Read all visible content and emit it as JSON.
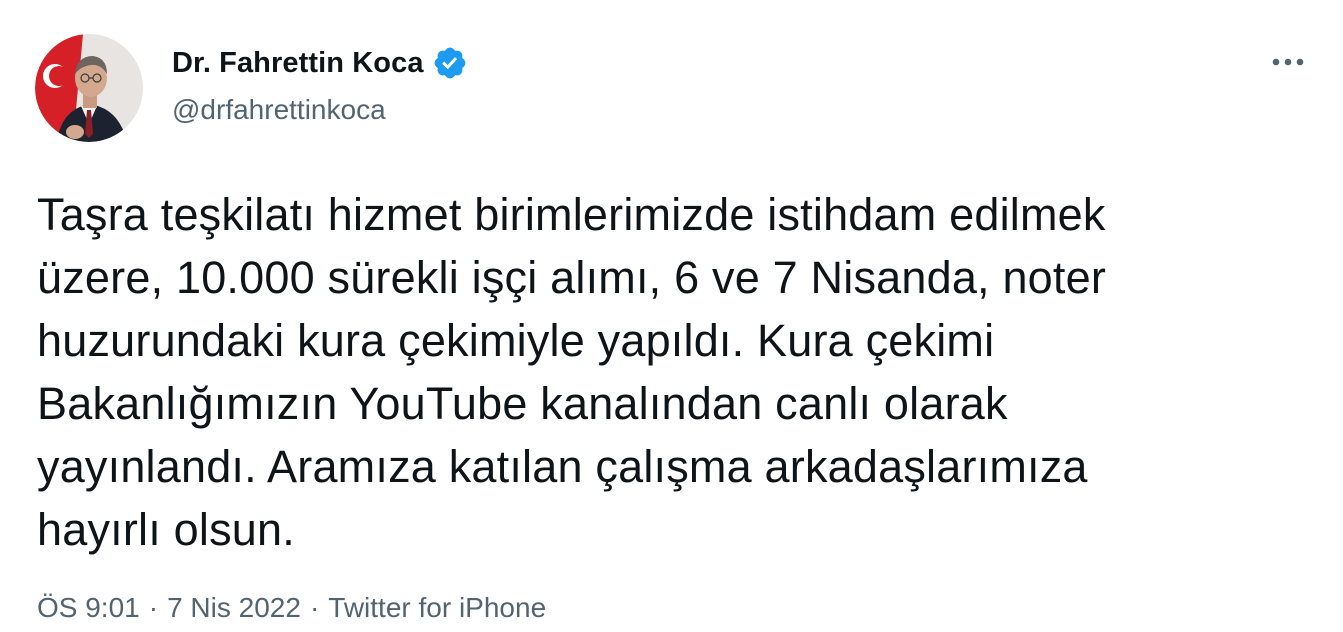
{
  "author": {
    "display_name": "Dr. Fahrettin Koca",
    "handle": "@drfahrettinkoca",
    "verified": true,
    "verified_color": "#1d9bf0"
  },
  "tweet": {
    "text": "Taşra teşkilatı hizmet birimlerimizde istihdam edilmek\nüzere, 10.000 sürekli işçi alımı, 6 ve 7 Nisanda, noter\nhuzurundaki kura çekimiyle yapıldı. Kura çekimi\nBakanlığımızın YouTube kanalından canlı olarak\nyayınlandı. Aramıza katılan çalışma arkadaşlarımıza\nhayırlı olsun."
  },
  "meta": {
    "time": "ÖS 9:01",
    "date": "7 Nis 2022",
    "source": "Twitter for iPhone",
    "separator": "·"
  },
  "icons": {
    "more": "more-horizontal-icon",
    "verified": "verified-badge-icon"
  },
  "colors": {
    "text_primary": "#0f1419",
    "text_secondary": "#536471",
    "accent": "#1d9bf0"
  }
}
